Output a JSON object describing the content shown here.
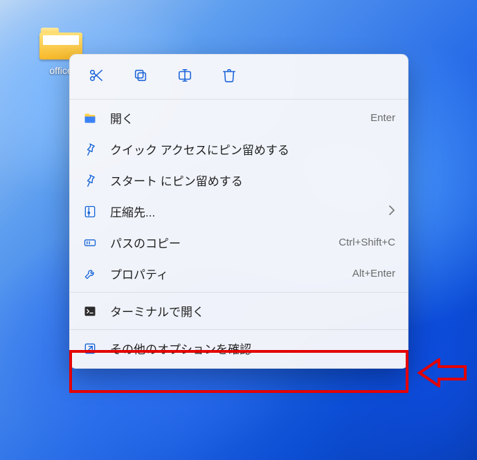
{
  "desktop": {
    "icon_label": "office"
  },
  "context_menu": {
    "top_buttons": {
      "cut": "cut-icon",
      "copy": "copy-icon",
      "rename": "rename-icon",
      "delete": "delete-icon"
    },
    "items": {
      "open": {
        "label": "開く",
        "shortcut": "Enter"
      },
      "pin_quick": {
        "label": "クイック アクセスにピン留めする"
      },
      "pin_start": {
        "label": "スタート にピン留めする"
      },
      "compress": {
        "label": "圧縮先...",
        "has_submenu": true
      },
      "copy_path": {
        "label": "パスのコピー",
        "shortcut": "Ctrl+Shift+C"
      },
      "properties": {
        "label": "プロパティ",
        "shortcut": "Alt+Enter"
      },
      "terminal": {
        "label": "ターミナルで開く"
      },
      "more": {
        "label": "その他のオプションを確認"
      }
    }
  }
}
